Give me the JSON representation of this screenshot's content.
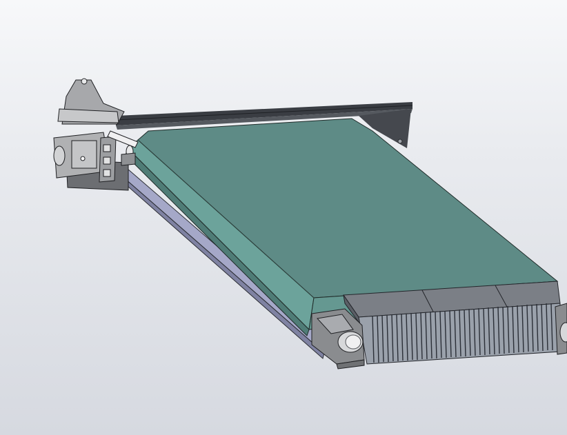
{
  "viewport": {
    "background_top": "#f7f8fa",
    "background_bottom": "#d6d9e0"
  },
  "model": {
    "cover_color": "#5e8b86",
    "cover_side_color": "#6ca39b",
    "pcb_edge_color": "#a5a8c8",
    "rail_color": "#3a3d43",
    "handle_color": "#b0b1b3",
    "faceplate_color": "#7b7f86",
    "fin_color": "#9aa1ab",
    "latch_color": "#8a8c8f"
  }
}
